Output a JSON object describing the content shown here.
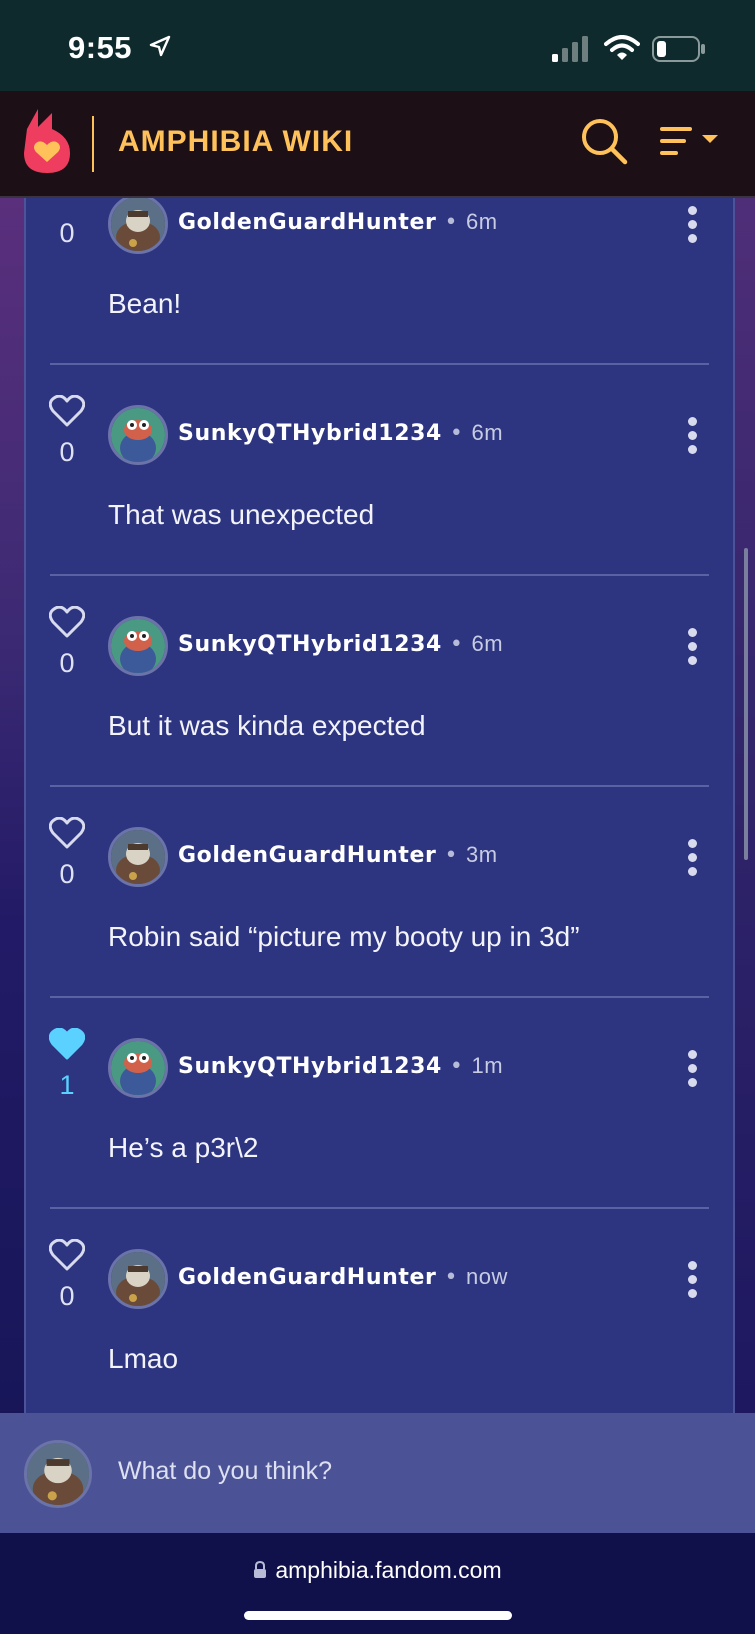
{
  "status_bar": {
    "time": "9:55",
    "icons": [
      "location-arrow-icon",
      "cell-signal-icon",
      "wifi-icon",
      "battery-icon"
    ]
  },
  "header": {
    "logo": "fandom-heart-flame-logo",
    "title": "AMPHIBIA WIKI",
    "accent_color": "#ffc15a"
  },
  "comments": [
    {
      "author": "GoldenGuardHunter",
      "time": "6m",
      "text": "Bean!",
      "likes": "0",
      "liked": false,
      "avatar": "golden-guard-avatar"
    },
    {
      "author": "SunkyQTHybrid1234",
      "time": "6m",
      "text": "That was unexpected",
      "likes": "0",
      "liked": false,
      "avatar": "frog-avatar"
    },
    {
      "author": "SunkyQTHybrid1234",
      "time": "6m",
      "text": "But it was kinda expected",
      "likes": "0",
      "liked": false,
      "avatar": "frog-avatar"
    },
    {
      "author": "GoldenGuardHunter",
      "time": "3m",
      "text": "Robin said “picture my booty up in 3d”",
      "likes": "0",
      "liked": false,
      "avatar": "golden-guard-avatar"
    },
    {
      "author": "SunkyQTHybrid1234",
      "time": "1m",
      "text": "He’s a p3r\\2",
      "likes": "1",
      "liked": true,
      "avatar": "frog-avatar"
    },
    {
      "author": "GoldenGuardHunter",
      "time": "now",
      "text": "Lmao",
      "likes": "0",
      "liked": false,
      "avatar": "golden-guard-avatar"
    }
  ],
  "reply": {
    "placeholder": "What do you think?"
  },
  "browser": {
    "url": "amphibia.fandom.com"
  },
  "colors": {
    "panel": "#2e3580",
    "like_active": "#5ad1ff",
    "header_bg": "#1d0f16"
  }
}
